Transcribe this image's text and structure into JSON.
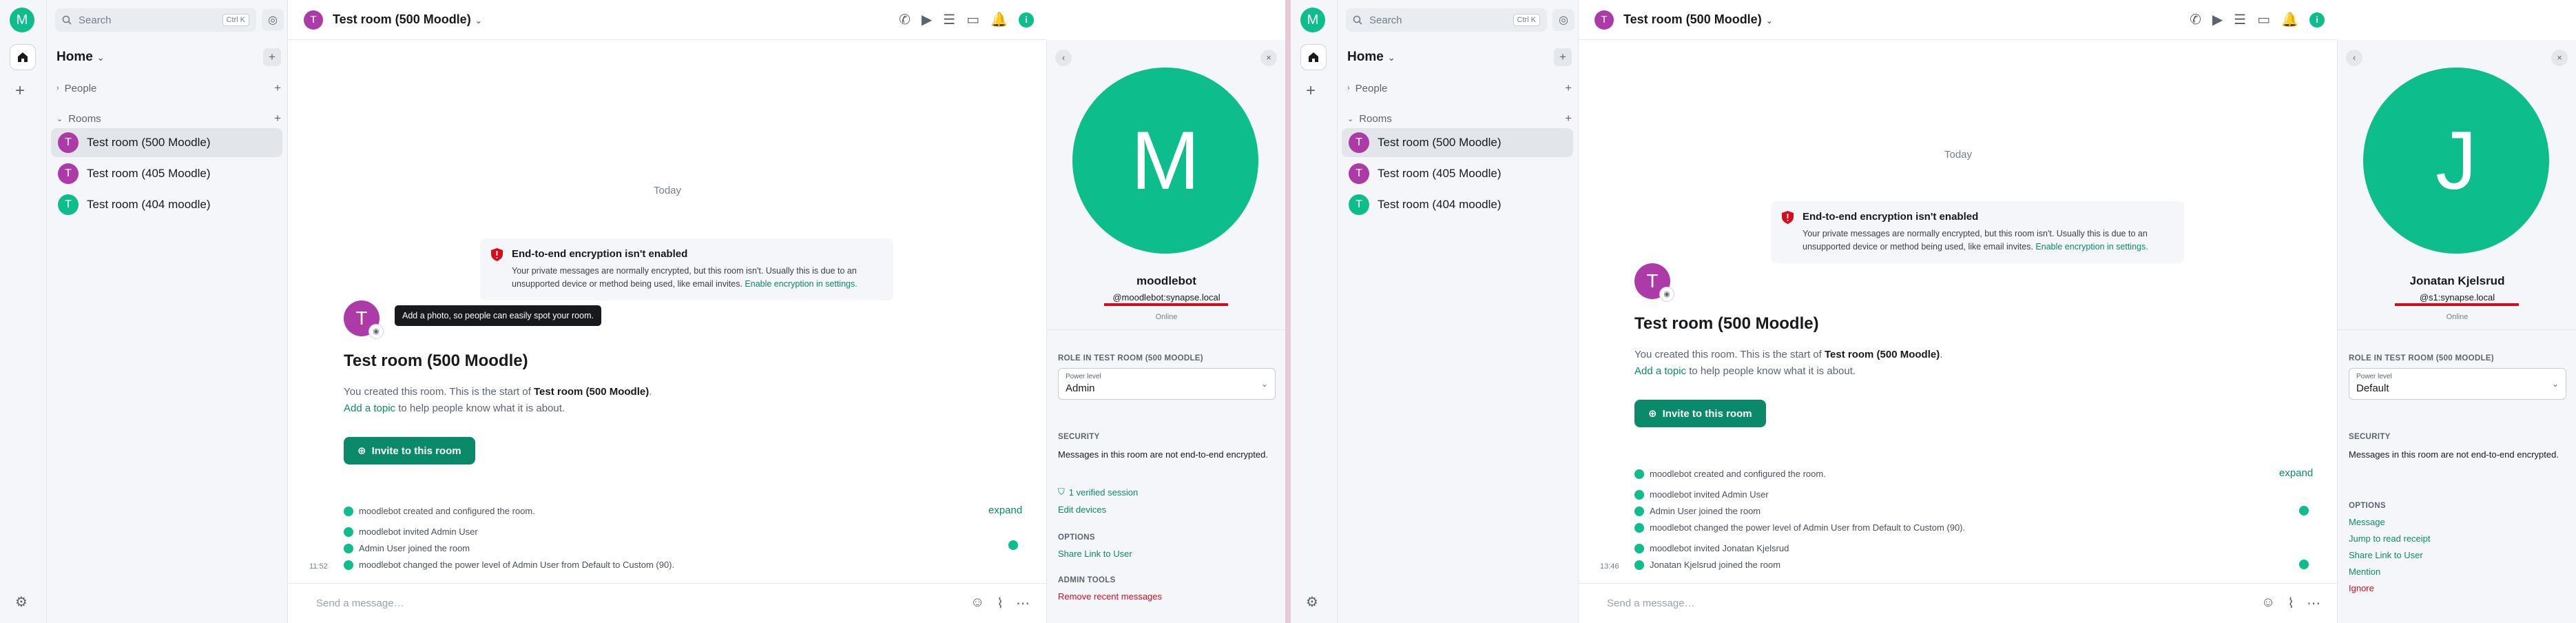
{
  "app": {
    "me_initial": "M",
    "search_placeholder": "Search",
    "search_shortcut": "Ctrl K",
    "home_label": "Home",
    "people_label": "People",
    "rooms_label": "Rooms",
    "rooms": [
      {
        "name": "Test room (500 Moodle)",
        "initial": "T",
        "color": "#ac3ba8"
      },
      {
        "name": "Test room (405 Moodle)",
        "initial": "T",
        "color": "#ac3ba8"
      },
      {
        "name": "Test room (404 moodle)",
        "initial": "T",
        "color": "#0dbd8b"
      }
    ],
    "room_title": "Test room (500 Moodle)",
    "room_initial": "T",
    "today_label": "Today",
    "e2e_title": "End-to-end encryption isn't enabled",
    "e2e_body_1": "Your private messages are normally encrypted, but this room isn't. Usually this is due to an",
    "e2e_body_2": "unsupported device or method being used, like email invites.",
    "e2e_link": "Enable encryption in settings.",
    "tooltip_text": "Add a photo, so people can easily spot your room.",
    "created_prefix": "You created this room. This is the start of",
    "created_room": "Test room (500 Moodle)",
    "created_period": ".",
    "add_topic": "Add a topic",
    "add_topic_suffix": "to help people know what it is about.",
    "invite_label": "Invite to this room",
    "expand_label": "expand",
    "composer_placeholder": "Send a message…",
    "info_icon_label": "i",
    "colors": {
      "accent": "#0dbd8b",
      "link": "#0a8a68",
      "danger": "#d40d1c",
      "room_avatar": "#ac3ba8"
    }
  },
  "left": {
    "events": [
      "moodlebot created and configured the room.",
      "moodlebot invited Admin User",
      "Admin User joined the room",
      "moodlebot changed the power level of Admin User from Default to Custom (90)."
    ],
    "timestamp": "11:52",
    "user": {
      "initial": "M",
      "name": "moodlebot",
      "id": "@moodlebot:synapse.local",
      "status": "Online"
    },
    "role_heading": "ROLE IN TEST ROOM (500 MOODLE)",
    "power_level_label": "Power level",
    "power_level_value": "Admin",
    "security_heading": "SECURITY",
    "security_text": "Messages in this room are not end-to-end encrypted.",
    "verified_sessions": "1 verified session",
    "edit_devices": "Edit devices",
    "options_heading": "OPTIONS",
    "share_link": "Share Link to User",
    "admin_heading": "ADMIN TOOLS",
    "remove_recent": "Remove recent messages"
  },
  "right": {
    "events": [
      "moodlebot created and configured the room.",
      "moodlebot invited Admin User",
      "Admin User joined the room",
      "moodlebot changed the power level of Admin User from Default to Custom (90).",
      "moodlebot invited Jonatan Kjelsrud",
      "Jonatan Kjelsrud joined the room"
    ],
    "timestamp": "13:46",
    "user": {
      "initial": "J",
      "name": "Jonatan Kjelsrud",
      "id": "@s1:synapse.local",
      "status": "Online"
    },
    "role_heading": "ROLE IN TEST ROOM (500 MOODLE)",
    "power_level_label": "Power level",
    "power_level_value": "Default",
    "security_heading": "SECURITY",
    "security_text": "Messages in this room are not end-to-end encrypted.",
    "options_heading": "OPTIONS",
    "message": "Message",
    "jump_read": "Jump to read receipt",
    "share_link": "Share Link to User",
    "mention": "Mention",
    "ignore": "Ignore"
  }
}
